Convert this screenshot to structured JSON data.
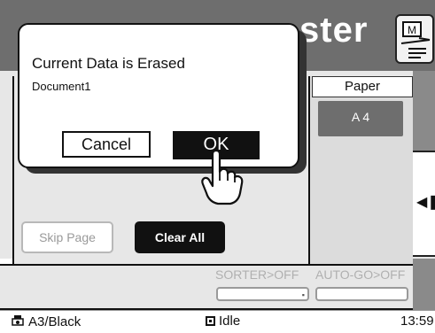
{
  "header": {
    "title_left": "",
    "title_right": "ster",
    "master_icon_letter": "M"
  },
  "dialog": {
    "message": "Current Data is Erased",
    "document_name": "Document1",
    "cancel_label": "Cancel",
    "ok_label": "OK"
  },
  "paper": {
    "label": "Paper",
    "size": "A 4"
  },
  "buttons": {
    "skip_page": "Skip Page",
    "clear_all": "Clear All"
  },
  "options": {
    "sorter_label": "SORTER>OFF",
    "autogo_label": "AUTO-GO>OFF"
  },
  "status": {
    "mode": "A3/Black",
    "state": "Idle",
    "time": "13:59"
  },
  "colors": {
    "header": "#6e6e6e",
    "panel": "#e7e7e7",
    "dark_button": "#111111",
    "disabled_text": "#9a9a9a"
  },
  "icons": {
    "master": "master-make-icon",
    "pointer": "hand-pointer-icon",
    "printer": "printer-icon",
    "idle": "idle-square-icon",
    "arrow": "left-arrow-icon"
  }
}
